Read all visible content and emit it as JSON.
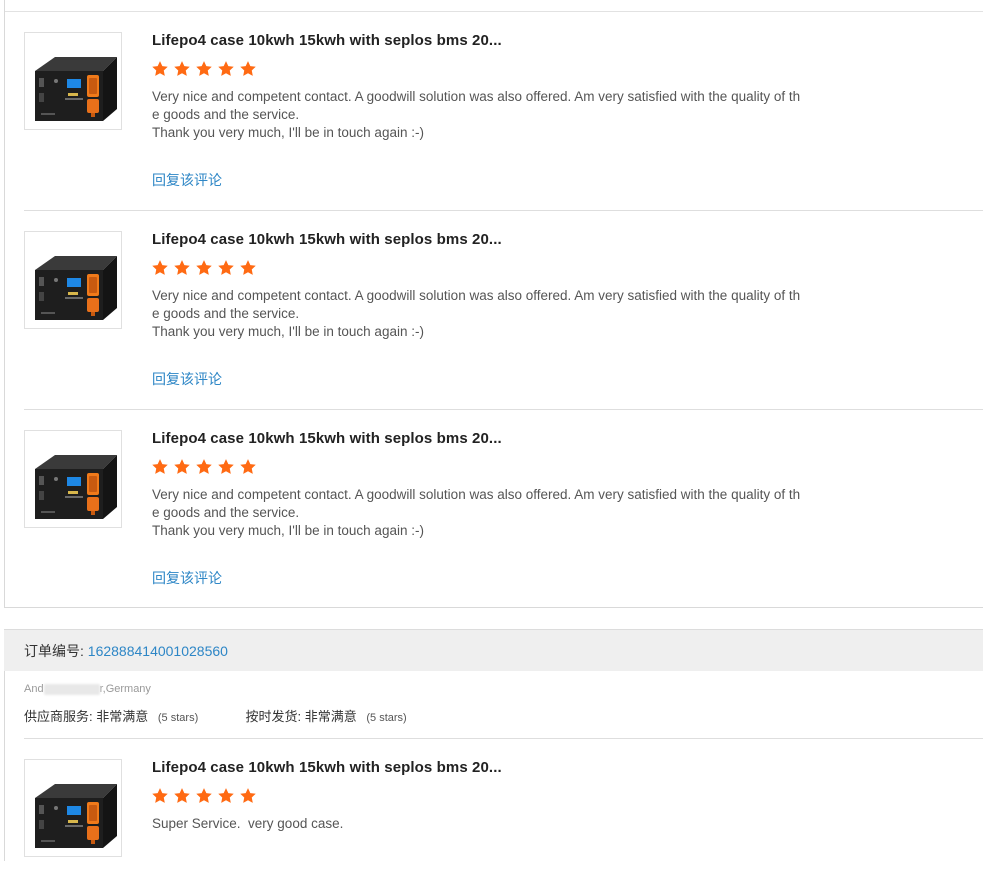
{
  "product_title": "Lifepo4 case 10kwh 15kwh with seplos bms 20...",
  "star_color": "#ff6a13",
  "link_color": "#2d86c6",
  "reviews": [
    {
      "rating": 5,
      "text": "Very nice and competent contact. A goodwill solution was also offered. Am very satisfied with the quality of the goods and the service.\nThank you very much, I'll be in touch again :-)",
      "reply_label": "回复该评论"
    },
    {
      "rating": 5,
      "text": "Very nice and competent contact. A goodwill solution was also offered. Am very satisfied with the quality of the goods and the service.\nThank you very much, I'll be in touch again :-)",
      "reply_label": "回复该评论"
    },
    {
      "rating": 5,
      "text": "Very nice and competent contact. A goodwill solution was also offered. Am very satisfied with the quality of the goods and the service.\nThank you very much, I'll be in touch again :-)",
      "reply_label": "回复该评论"
    }
  ],
  "order": {
    "label": "订单编号:",
    "number": "162888414001028560",
    "buyer_prefix": "And",
    "buyer_suffix": "r,Germany",
    "supplier_service_label": "供应商服务:",
    "supplier_service_value": "非常满意",
    "supplier_service_stars": "(5 stars)",
    "shipping_label": "按时发货:",
    "shipping_value": "非常满意",
    "shipping_stars": "(5 stars)",
    "review": {
      "rating": 5,
      "text": "Super Service.  very good case."
    }
  }
}
